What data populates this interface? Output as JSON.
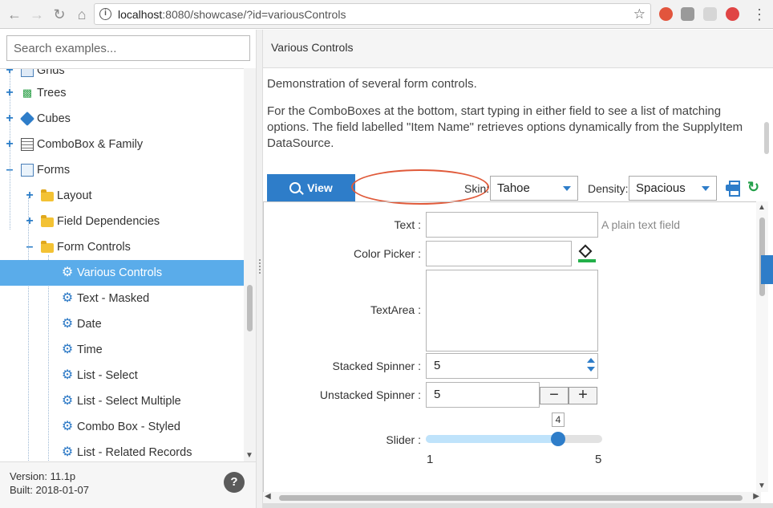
{
  "browser": {
    "url_host": "localhost",
    "url_rest": ":8080/showcase/?id=variousControls"
  },
  "sidebar": {
    "search_placeholder": "Search examples...",
    "items": [
      {
        "label": "Grids",
        "icon": "grid-icon"
      },
      {
        "label": "Trees",
        "icon": "tree-icon"
      },
      {
        "label": "Cubes",
        "icon": "cube-icon"
      },
      {
        "label": "ComboBox & Family",
        "icon": "combobox-icon"
      },
      {
        "label": "Forms",
        "icon": "form-icon"
      },
      {
        "label": "Layout",
        "icon": "folder-icon"
      },
      {
        "label": "Field Dependencies",
        "icon": "folder-icon"
      },
      {
        "label": "Form Controls",
        "icon": "folder-gear-icon"
      },
      {
        "label": "Various Controls",
        "icon": "gear-icon"
      },
      {
        "label": "Text - Masked",
        "icon": "gear-icon"
      },
      {
        "label": "Date",
        "icon": "gear-icon"
      },
      {
        "label": "Time",
        "icon": "gear-icon"
      },
      {
        "label": "List - Select",
        "icon": "gear-icon"
      },
      {
        "label": "List - Select Multiple",
        "icon": "gear-icon"
      },
      {
        "label": "Combo Box - Styled",
        "icon": "gear-icon"
      },
      {
        "label": "List - Related Records",
        "icon": "gear-icon"
      }
    ],
    "version": "Version: 11.1p",
    "built": "Built: 2018-01-07",
    "help_label": "?"
  },
  "main": {
    "title": "Various Controls",
    "desc1": "Demonstration of several form controls.",
    "desc2": "For the ComboBoxes at the bottom, start typing in either field to see a list of matching options. The field labelled \"Item Name\" retrieves options dynamically from the SupplyItem DataSource.",
    "view_tab": "View",
    "skin_label": "Skin:",
    "skin_value": "Tahoe",
    "density_label": "Density:",
    "density_value": "Spacious"
  },
  "form": {
    "text_label": "Text :",
    "text_hint": "A plain text field",
    "color_label": "Color Picker :",
    "textarea_label": "TextArea :",
    "stacked_label": "Stacked Spinner :",
    "stacked_value": "5",
    "unstacked_label": "Unstacked Spinner :",
    "unstacked_value": "5",
    "slider_label": "Slider :",
    "slider_value": "4",
    "slider_min": "1",
    "slider_max": "5",
    "minus": "−",
    "plus": "+"
  },
  "colors": {
    "accent": "#2e7dc9",
    "selected_row": "#5aacea",
    "annotation": "#e05a3a"
  }
}
